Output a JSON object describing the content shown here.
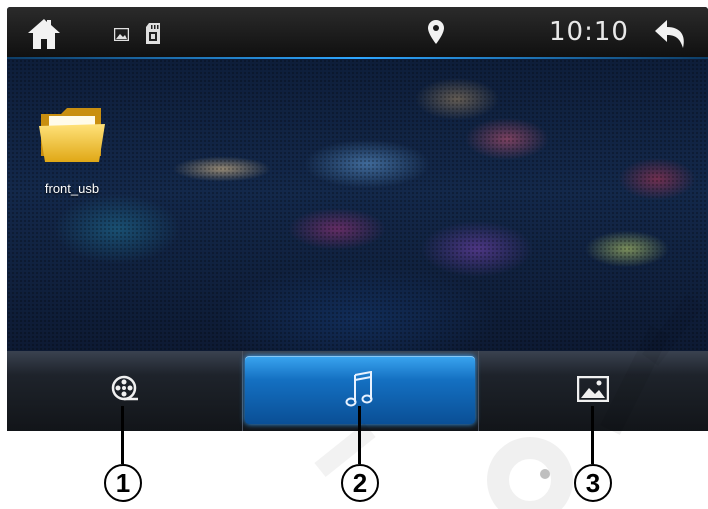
{
  "status_bar": {
    "time": "10:10",
    "icons": [
      "home-icon",
      "picture-icon",
      "sd-card-icon",
      "location-pin-icon",
      "back-arrow-icon"
    ]
  },
  "desktop": {
    "folder_label": "front_usb"
  },
  "tabs": [
    {
      "name": "video",
      "icon": "film-reel-icon",
      "selected": false
    },
    {
      "name": "music",
      "icon": "music-note-icon",
      "selected": true
    },
    {
      "name": "photo",
      "icon": "photo-icon",
      "selected": false
    }
  ],
  "callouts": [
    "1",
    "2",
    "3"
  ],
  "colors": {
    "accent": "#1a7fd6",
    "status_line": "#2ea6ff",
    "bar": "#1e232b"
  }
}
